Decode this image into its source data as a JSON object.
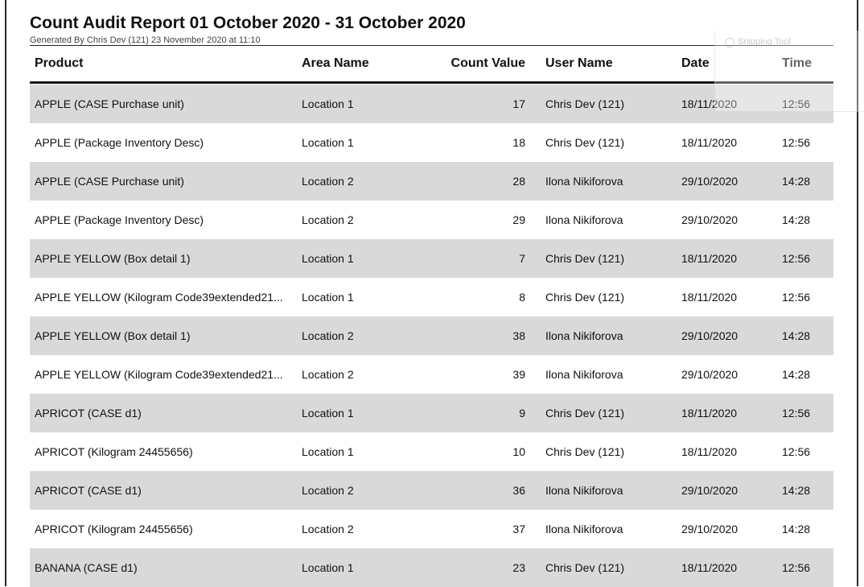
{
  "report": {
    "title": "Count Audit Report 01 October 2020 - 31 October 2020",
    "generated": "Generated By Chris Dev (121) 23 November 2020 at 11:10"
  },
  "columns": {
    "product": "Product",
    "area": "Area Name",
    "count": "Count Value",
    "user": "User Name",
    "date": "Date",
    "time": "Time"
  },
  "rows": [
    {
      "product": "APPLE (CASE Purchase unit)",
      "area": "Location 1",
      "count": "17",
      "user": "Chris Dev (121)",
      "date": "18/11/2020",
      "time": "12:56"
    },
    {
      "product": "APPLE (Package Inventory Desc)",
      "area": "Location 1",
      "count": "18",
      "user": "Chris Dev (121)",
      "date": "18/11/2020",
      "time": "12:56"
    },
    {
      "product": "APPLE (CASE Purchase unit)",
      "area": "Location 2",
      "count": "28",
      "user": "Ilona Nikiforova",
      "date": "29/10/2020",
      "time": "14:28"
    },
    {
      "product": "APPLE (Package Inventory Desc)",
      "area": "Location 2",
      "count": "29",
      "user": "Ilona Nikiforova",
      "date": "29/10/2020",
      "time": "14:28"
    },
    {
      "product": "APPLE YELLOW (Box detail 1)",
      "area": "Location 1",
      "count": "7",
      "user": "Chris Dev (121)",
      "date": "18/11/2020",
      "time": "12:56"
    },
    {
      "product": "APPLE YELLOW (Kilogram Code39extended21...",
      "area": "Location 1",
      "count": "8",
      "user": "Chris Dev (121)",
      "date": "18/11/2020",
      "time": "12:56"
    },
    {
      "product": "APPLE YELLOW (Box detail 1)",
      "area": "Location 2",
      "count": "38",
      "user": "Ilona Nikiforova",
      "date": "29/10/2020",
      "time": "14:28"
    },
    {
      "product": "APPLE YELLOW (Kilogram Code39extended21...",
      "area": "Location 2",
      "count": "39",
      "user": "Ilona Nikiforova",
      "date": "29/10/2020",
      "time": "14:28"
    },
    {
      "product": "APRICOT (CASE d1)",
      "area": "Location 1",
      "count": "9",
      "user": "Chris Dev (121)",
      "date": "18/11/2020",
      "time": "12:56"
    },
    {
      "product": "APRICOT (Kilogram 24455656)",
      "area": "Location 1",
      "count": "10",
      "user": "Chris Dev (121)",
      "date": "18/11/2020",
      "time": "12:56"
    },
    {
      "product": "APRICOT (CASE d1)",
      "area": "Location 2",
      "count": "36",
      "user": "Ilona Nikiforova",
      "date": "29/10/2020",
      "time": "14:28"
    },
    {
      "product": "APRICOT (Kilogram 24455656)",
      "area": "Location 2",
      "count": "37",
      "user": "Ilona Nikiforova",
      "date": "29/10/2020",
      "time": "14:28"
    },
    {
      "product": "BANANA (CASE d1)",
      "area": "Location 1",
      "count": "23",
      "user": "Chris Dev (121)",
      "date": "18/11/2020",
      "time": "12:56"
    }
  ],
  "overlay": {
    "label": "Snipping Tool",
    "icon": "scissors-icon"
  },
  "colors": {
    "shaded_row": "#d9d9d9",
    "rule": "#111111"
  }
}
